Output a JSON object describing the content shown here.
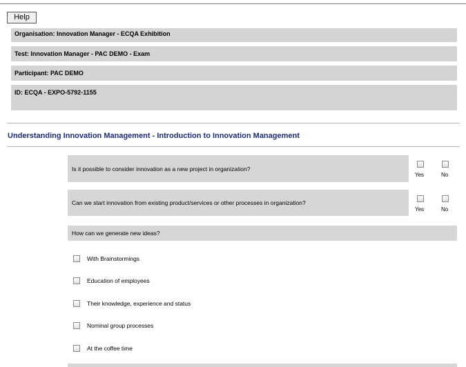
{
  "toolbar": {
    "help_label": "Help"
  },
  "info": {
    "organisation": "Organisation: Innovation Manager - ECQA Exhibition",
    "test": "Test: Innovation Manager - PAC DEMO - Exam",
    "participant": "Participant: PAC DEMO",
    "id": "ID: ECQA - EXPO-5792-1155"
  },
  "section": {
    "title": "Understanding Innovation Management - Introduction to Innovation Management"
  },
  "questions": [
    {
      "text": "Is it possible to consider innovation as a new project in organization?",
      "yes_label": "Yes",
      "no_label": "No"
    },
    {
      "text": "Can we start innovation from existing product/services or other processes in organization?",
      "yes_label": "Yes",
      "no_label": "No"
    },
    {
      "text": "How can we generate new ideas?",
      "options": [
        "With Brainstormings",
        "Education of employees",
        "Their knowledge, experience and status",
        "Nominal group processes",
        "At the coffee time"
      ]
    }
  ]
}
